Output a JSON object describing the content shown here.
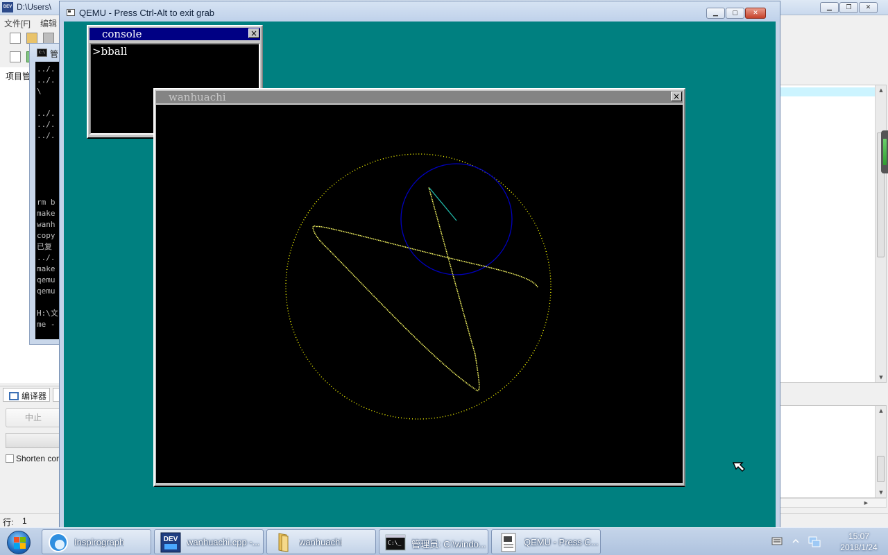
{
  "devcpp": {
    "title": "D:\\Users\\",
    "menu": [
      "文件[F]",
      "编辑"
    ],
    "left_tab": "项目管",
    "bottom_tab": "编译器",
    "compile_button": "中止",
    "shorten_label": "Shorten cor",
    "status_line_label": "行:",
    "status_line_value": "1"
  },
  "cmd": {
    "title": "管",
    "lines": [
      "../.",
      "../.",
      " \\",
      "../.",
      "../.",
      "../.",
      "rm b",
      "make",
      "wanh",
      "copy",
      "已复",
      "../.",
      "make",
      "qemu",
      "qemu",
      "H:\\文",
      "me -"
    ]
  },
  "qemu": {
    "title": "QEMU - Press Ctrl-Alt to exit grab",
    "desktop_color": "#008080"
  },
  "console_window": {
    "title": "console",
    "close_glyph": "×",
    "prompt": ">bball"
  },
  "wanhuachi_window": {
    "title": "wanhuachi",
    "close_glyph": "×"
  },
  "taskbar": {
    "items": [
      {
        "label": "Inspirograph",
        "icon": "inspirograph-icon"
      },
      {
        "label": "wanhuachi.cpp -...",
        "icon": "devcpp-icon"
      },
      {
        "label": "wanhuachi",
        "icon": "folder-icon"
      },
      {
        "label": "管理员: C:\\windo...",
        "icon": "cmd-icon"
      },
      {
        "label": "QEMU - Press C...",
        "icon": "qemu-icon"
      }
    ],
    "time": "15:07",
    "date": "2018/1/24"
  },
  "colors": {
    "outer_circle": "#ffff00",
    "inner_circle": "#0000c0",
    "curve": "#ffff66",
    "radius_line": "#20b8a8"
  }
}
